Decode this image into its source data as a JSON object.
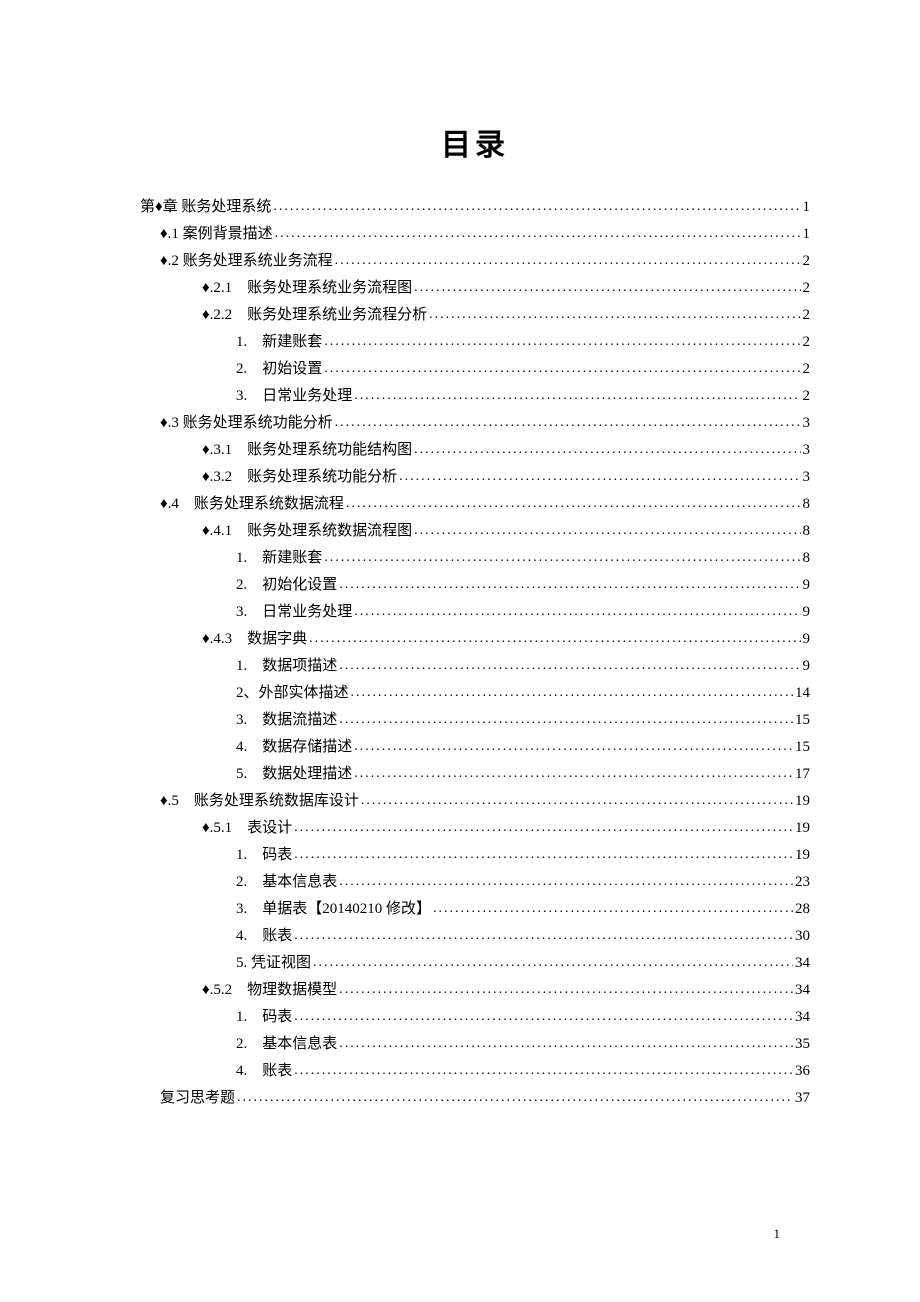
{
  "title": "目录",
  "page_number": "1",
  "toc": [
    {
      "level": 0,
      "label": "第♦章  账务处理系统",
      "page": "1"
    },
    {
      "level": 1,
      "label": "♦.1 案例背景描述",
      "page": "1"
    },
    {
      "level": 1,
      "label": "♦.2 账务处理系统业务流程",
      "page": "2"
    },
    {
      "level": 2,
      "label": "♦.2.1　账务处理系统业务流程图",
      "page": "2"
    },
    {
      "level": 2,
      "label": "♦.2.2　账务处理系统业务流程分析",
      "page": "2"
    },
    {
      "level": 3,
      "label": "1.　新建账套",
      "page": "2"
    },
    {
      "level": 3,
      "label": "2.　初始设置",
      "page": "2"
    },
    {
      "level": 3,
      "label": "3.　日常业务处理",
      "page": "2"
    },
    {
      "level": 1,
      "label": "♦.3 账务处理系统功能分析",
      "page": "3"
    },
    {
      "level": 2,
      "label": "♦.3.1　账务处理系统功能结构图",
      "page": "3"
    },
    {
      "level": 2,
      "label": "♦.3.2　账务处理系统功能分析",
      "page": "3"
    },
    {
      "level": 1,
      "label": "♦.4　账务处理系统数据流程",
      "page": "8"
    },
    {
      "level": 2,
      "label": "♦.4.1　账务处理系统数据流程图",
      "page": "8"
    },
    {
      "level": 3,
      "label": "1.　新建账套",
      "page": "8"
    },
    {
      "level": 3,
      "label": "2.　初始化设置",
      "page": "9"
    },
    {
      "level": 3,
      "label": "3.　日常业务处理",
      "page": "9"
    },
    {
      "level": 2,
      "label": "♦.4.3　数据字典",
      "page": "9"
    },
    {
      "level": 3,
      "label": "1.　数据项描述",
      "page": "9"
    },
    {
      "level": 3,
      "label": "2、外部实体描述",
      "page": "14"
    },
    {
      "level": 3,
      "label": "3.　数据流描述",
      "page": "15"
    },
    {
      "level": 3,
      "label": "4.　数据存储描述",
      "page": "15"
    },
    {
      "level": 3,
      "label": "5.　数据处理描述",
      "page": "17"
    },
    {
      "level": 1,
      "label": "♦.5　账务处理系统数据库设计",
      "page": "19"
    },
    {
      "level": 2,
      "label": "♦.5.1　表设计",
      "page": "19"
    },
    {
      "level": 3,
      "label": "1.　码表",
      "page": "19"
    },
    {
      "level": 3,
      "label": "2.　基本信息表",
      "page": "23"
    },
    {
      "level": 3,
      "label": "3.　单据表【20140210 修改】",
      "page": "28"
    },
    {
      "level": 3,
      "label": "4.　账表",
      "page": "30"
    },
    {
      "level": 3,
      "label": "5. 凭证视图",
      "page": "34"
    },
    {
      "level": 2,
      "label": "♦.5.2　物理数据模型",
      "page": "34"
    },
    {
      "level": 3,
      "label": "1.　码表",
      "page": "34"
    },
    {
      "level": 3,
      "label": "2.　基本信息表",
      "page": "35"
    },
    {
      "level": 3,
      "label": "4.　账表",
      "page": "36"
    },
    {
      "level": 1,
      "label": "复习思考题",
      "page": "37"
    }
  ]
}
